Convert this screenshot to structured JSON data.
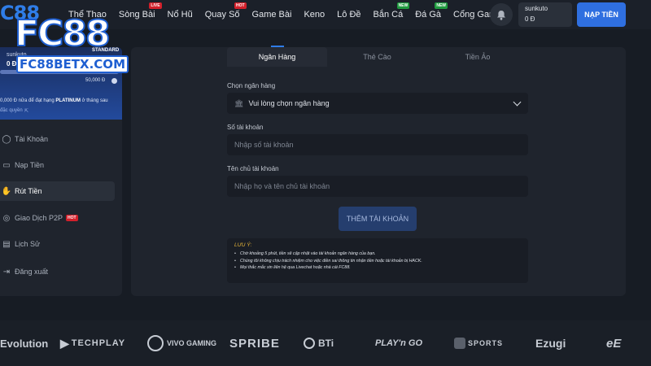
{
  "logo": {
    "c88": "C88",
    "fc88": "FC88",
    "standard": "STANDARD",
    "domain": "FC88BETX.COM"
  },
  "nav": [
    {
      "label": "Thể Thao",
      "badge": ""
    },
    {
      "label": "Sòng Bài",
      "badge": "LIVE"
    },
    {
      "label": "Nổ Hũ",
      "badge": ""
    },
    {
      "label": "Quay Số",
      "badge": "HOT"
    },
    {
      "label": "Game Bài",
      "badge": ""
    },
    {
      "label": "Keno",
      "badge": ""
    },
    {
      "label": "Lô Đề",
      "badge": ""
    },
    {
      "label": "Bắn Cá",
      "badge": "NEW"
    },
    {
      "label": "Đá Gà",
      "badge": "NEW"
    },
    {
      "label": "Cổng Game",
      "badge": ""
    }
  ],
  "user": {
    "name": "sunkuto",
    "balance": "0 Đ",
    "deposit_label": "NẠP TIỀN"
  },
  "profile": {
    "name": "sunkuto",
    "balance": "0 Đ",
    "progress": 0,
    "target": "50,000 Đ",
    "next_rank_prefix": "0,000 Đ nữa để đạt hạng",
    "next_rank_name": "PLATINUM",
    "next_rank_suffix": "ở tháng sau",
    "perks": "đặc quyền"
  },
  "menu": [
    {
      "label": "Tài Khoản",
      "icon": "user-icon"
    },
    {
      "label": "Nạp Tiền",
      "icon": "wallet-icon"
    },
    {
      "label": "Rút Tiền",
      "icon": "withdraw-icon"
    },
    {
      "label": "Giao Dịch P2P",
      "icon": "p2p-icon",
      "badge": "HOT"
    },
    {
      "label": "Lịch Sử",
      "icon": "history-icon"
    },
    {
      "label": "Đăng xuất",
      "icon": "logout-icon"
    }
  ],
  "tabs": [
    "Ngân Hàng",
    "Thẻ Cào",
    "Tiền Ảo"
  ],
  "form": {
    "bank_label": "Chọn ngân hàng",
    "bank_placeholder": "Vui lòng chọn ngân hàng",
    "account_no_label": "Số tài khoản",
    "account_no_placeholder": "Nhập số tài khoản",
    "holder_label": "Tên chủ tài khoản",
    "holder_placeholder": "Nhập họ và tên chủ tài khoản",
    "add_button": "THÊM TÀI KHOẢN"
  },
  "note": {
    "title": "LƯU Ý:",
    "items": [
      "Chờ khoảng 5 phút, tiền sẽ cập nhật vào tài khoản ngân hàng của bạn.",
      "Chúng tôi không chịu trách nhiệm cho việc điền sai thông tin nhận tiền hoặc tài khoản bị HACK.",
      "Mọi thắc mắc xin liên hệ qua Livechat hoặc nhà cái FC88."
    ]
  },
  "providers": [
    "Evolution",
    "TECHPLAY",
    "VIVO GAMING",
    "SPRIBE",
    "BTi",
    "PLAY'n GO",
    "SPORTS",
    "Ezugi",
    "eE"
  ]
}
